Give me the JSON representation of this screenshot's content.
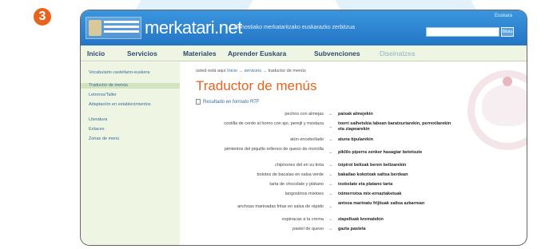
{
  "step_number": "3",
  "header": {
    "logo_alt": "site logo",
    "site_title": "merkatari.net",
    "tagline": "Donostiako merkataritzako euskarazko zerbitzua",
    "top_link": "Euskara",
    "search_placeholder": "",
    "search_button": "Bilatu"
  },
  "nav": {
    "items": [
      {
        "label": "Inicio"
      },
      {
        "label": "Servicios"
      },
      {
        "label": "Materiales"
      },
      {
        "label": "Aprender Euskara"
      },
      {
        "label": "Subvenciones"
      },
      {
        "label": "Diseinatzea"
      }
    ]
  },
  "sidebar": {
    "items": [
      {
        "label": "Vocabulario castellano-euskera"
      },
      {
        "label": "Traductor de menús"
      },
      {
        "label": "Letreros/Taller"
      },
      {
        "label": "Adaptación en establecimientos"
      },
      {
        "label": "Literatura"
      },
      {
        "label": "Enlaces"
      },
      {
        "label": "Zonas de menú"
      }
    ]
  },
  "content": {
    "breadcrumb_prefix": "usted está aquí",
    "breadcrumb_home": "Inicio",
    "breadcrumb_mid": "servicios",
    "breadcrumb_current": "traductor de menús",
    "title": "Traductor de menús",
    "rtf_link": "Resultado en formato RTF",
    "arrow": "→",
    "rows": [
      {
        "es": "pechos con almejas",
        "eu": "paisak almejekin"
      },
      {
        "es": "costilla de cerdo al horno con ajo, perejil y mostaza",
        "eu": "txerri saihetskia labean baratxuriarekin, perrexilarekin eta ziapearekin"
      },
      {
        "es": "atún encebollado",
        "eu": "atuna tipularekin"
      },
      {
        "es": "pimientos del piquillo rellenos de queso de morcilla",
        "eu": "piklilo piperra zenker hasagiar betetsute"
      },
      {
        "es": "chipirones del en su tinta",
        "eu": "txipiroi beltzak beren beltzarekin"
      },
      {
        "es": "bolotes de bacalao en salsa verde",
        "eu": "bakailao kokotxak saltsa berdean"
      },
      {
        "es": "tarta de chocolate y plátano",
        "eu": "txokolate eta platano tarta"
      },
      {
        "es": "langostinos mixtoes",
        "eu": "tximerrotxa mix-ernaztaketuak"
      },
      {
        "es": "anchoas marinadas fritas en salsa de rápido",
        "eu": "antxoa marinatu frijituak saltsa azkarrean"
      },
      {
        "es": "espinacas a la crema",
        "eu": "ziapelluak krematekin"
      },
      {
        "es": "pastel de queso",
        "eu": "gazta pastela"
      }
    ]
  }
}
